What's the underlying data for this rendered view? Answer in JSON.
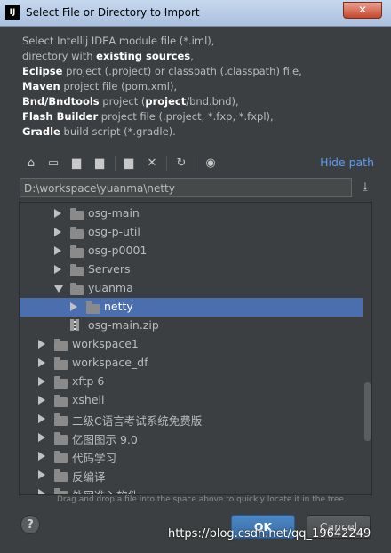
{
  "window": {
    "title": "Select File or Directory to Import",
    "app_icon": "IJ",
    "close_glyph": "✕"
  },
  "description": {
    "lines": [
      [
        {
          "t": "Select Intellij IDEA module file (*.iml),",
          "b": false
        }
      ],
      [
        {
          "t": "directory with ",
          "b": false
        },
        {
          "t": "existing sources",
          "b": true
        },
        {
          "t": ",",
          "b": false
        }
      ],
      [
        {
          "t": "Eclipse",
          "b": true
        },
        {
          "t": " project (.project) or classpath (.classpath) file,",
          "b": false
        }
      ],
      [
        {
          "t": "Maven",
          "b": true
        },
        {
          "t": " project file (pom.xml),",
          "b": false
        }
      ],
      [
        {
          "t": "Bnd/Bndtools",
          "b": true
        },
        {
          "t": " project (",
          "b": false
        },
        {
          "t": "project",
          "b": true
        },
        {
          "t": "/bnd.bnd),",
          "b": false
        }
      ],
      [
        {
          "t": "Flash Builder",
          "b": true
        },
        {
          "t": " project file (.project, *.fxp, *.fxpl),",
          "b": false
        }
      ],
      [
        {
          "t": "Gradle",
          "b": true
        },
        {
          "t": " build script (*.gradle).",
          "b": false
        }
      ]
    ]
  },
  "toolbar": {
    "icons": [
      "home-icon",
      "desktop-icon",
      "project-folder-icon",
      "module-folder-icon",
      "new-folder-icon",
      "delete-icon",
      "refresh-icon",
      "show-hidden-icon"
    ],
    "hide_path_label": "Hide path"
  },
  "path": {
    "value": "D:\\workspace\\yuanma\\netty"
  },
  "tree": {
    "items": [
      {
        "label": "osg-main",
        "level": 2,
        "expand": "right",
        "type": "folder"
      },
      {
        "label": "osg-p-util",
        "level": 2,
        "expand": "right",
        "type": "folder"
      },
      {
        "label": "osg-p0001",
        "level": 2,
        "expand": "right",
        "type": "folder"
      },
      {
        "label": "Servers",
        "level": 2,
        "expand": "right",
        "type": "folder"
      },
      {
        "label": "yuanma",
        "level": 2,
        "expand": "down",
        "type": "folder"
      },
      {
        "label": "netty",
        "level": 3,
        "expand": "right",
        "type": "folder",
        "selected": true
      },
      {
        "label": "osg-main.zip",
        "level": 2,
        "expand": "none",
        "type": "zip"
      },
      {
        "label": "workspace1",
        "level": 1,
        "expand": "right",
        "type": "folder"
      },
      {
        "label": "workspace_df",
        "level": 1,
        "expand": "right",
        "type": "folder"
      },
      {
        "label": "xftp 6",
        "level": 1,
        "expand": "right",
        "type": "folder"
      },
      {
        "label": "xshell",
        "level": 1,
        "expand": "right",
        "type": "folder"
      },
      {
        "label": "二级C语言考试系统免费版",
        "level": 1,
        "expand": "right",
        "type": "folder"
      },
      {
        "label": "亿图图示 9.0",
        "level": 1,
        "expand": "right",
        "type": "folder"
      },
      {
        "label": "代码学习",
        "level": 1,
        "expand": "right",
        "type": "folder"
      },
      {
        "label": "反编译",
        "level": 1,
        "expand": "right",
        "type": "folder"
      },
      {
        "label": "外网准入软件",
        "level": 1,
        "expand": "right",
        "type": "folder"
      }
    ]
  },
  "hint": "Drag and drop a file into the space above to quickly locate it in the tree",
  "buttons": {
    "help": "?",
    "ok": "OK",
    "cancel": "Cancel"
  },
  "watermark": "https://blog.csdn.net/qq_19642249"
}
